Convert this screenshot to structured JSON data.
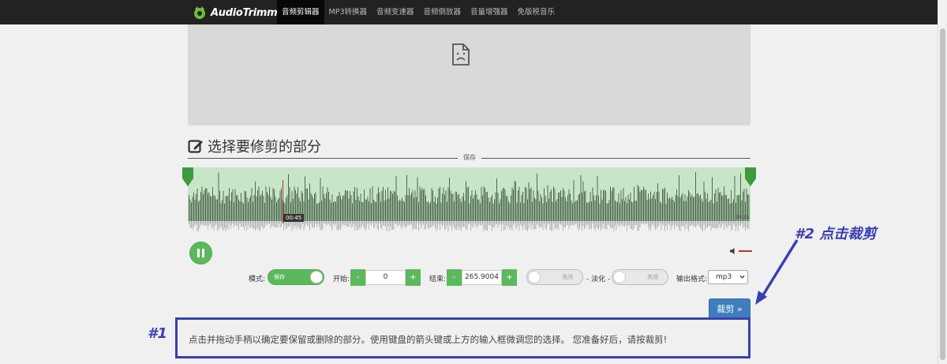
{
  "navbar": {
    "brand": "AudioTrimmer",
    "items": [
      {
        "label": "音频剪辑器",
        "active": true
      },
      {
        "label": "MP3转换器",
        "active": false
      },
      {
        "label": "音频变速器",
        "active": false
      },
      {
        "label": "音频倒放器",
        "active": false
      },
      {
        "label": "音量增强器",
        "active": false
      },
      {
        "label": "免版税音乐",
        "active": false
      }
    ]
  },
  "section": {
    "heading": "选择要修剪的部分",
    "divider_label": "保存"
  },
  "waveform": {
    "start_time": "00:45",
    "end_time": "04:25"
  },
  "controls": {
    "mode_label": "模式:",
    "mode_toggle": "保存",
    "start_label": "开始:",
    "start_value": "0",
    "end_label": "结束:",
    "end_value": "265.9004",
    "fade_in_toggle": "关闭",
    "fade_separator": "- 淡化 -",
    "fade_out_toggle": "关闭",
    "format_label": "输出格式:",
    "format_value": "mp3",
    "minus": "-",
    "plus": "+"
  },
  "crop_button": "裁剪 »",
  "annotations": {
    "step1": "#1",
    "step2": "#2 点击裁剪",
    "instruction": "点击并拖动手柄以确定要保留或删除的部分。使用键盘的箭头键或上方的输入框微调您的选择。 您准备好后，请按裁剪!"
  },
  "colors": {
    "accent_green": "#5cb85c",
    "crop_blue": "#3f7dbd",
    "annotation_blue": "#3a3fb0",
    "navbar": "#222222"
  }
}
